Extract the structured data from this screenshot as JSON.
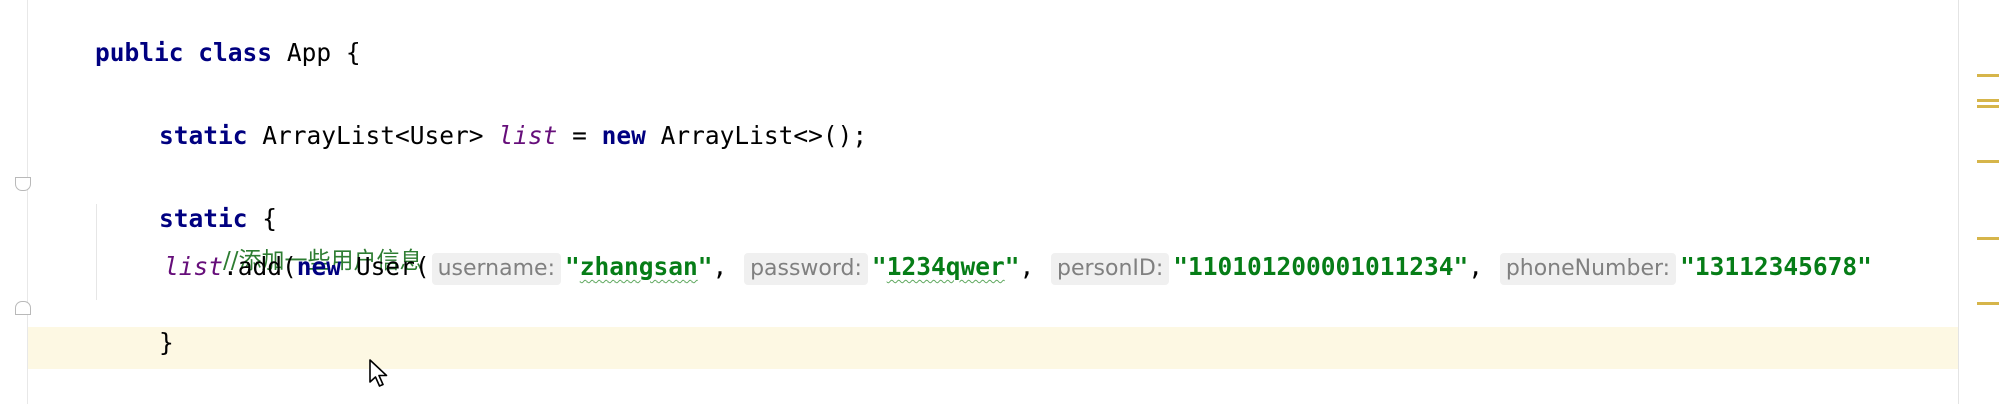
{
  "editor": {
    "lines": {
      "class_decl": {
        "kw1": "public",
        "kw2": "class",
        "name": "App {"
      },
      "field_decl": {
        "kw": "static",
        "type": "ArrayList<User>",
        "name": "list",
        "eq": "=",
        "kw_new": "new",
        "init": "ArrayList<>();"
      },
      "static_block": {
        "kw": "static",
        "brace": "{"
      },
      "comment": {
        "text": "//添加一些用户信息"
      },
      "add_call": {
        "target": "list",
        "method": ".add(",
        "kw_new": "new",
        "ctor": "User(",
        "hint_username": "username:",
        "val_username_q": "\"",
        "val_username": "zhangsan",
        "val_username_q2": "\"",
        "sep1": ",",
        "hint_password": "password:",
        "val_password_q": "\"",
        "val_password": "1234qwer",
        "val_password_q2": "\"",
        "sep2": ",",
        "hint_person": "personID:",
        "val_person": "\"110101200001011234\"",
        "sep3": ",",
        "hint_phone": "phoneNumber:",
        "val_phone": "\"13112345678\""
      },
      "close_brace": {
        "text": "}"
      }
    },
    "colors": {
      "keyword": "#000080",
      "field": "#660e7a",
      "string": "#067d17",
      "comment": "#2e7d32",
      "current_line": "#fdf8e3",
      "marker": "#d6b54a"
    },
    "icons": {
      "fold_start": "fold-start-icon",
      "fold_end": "fold-end-icon",
      "mouse_pointer": "mouse-pointer-icon"
    }
  }
}
